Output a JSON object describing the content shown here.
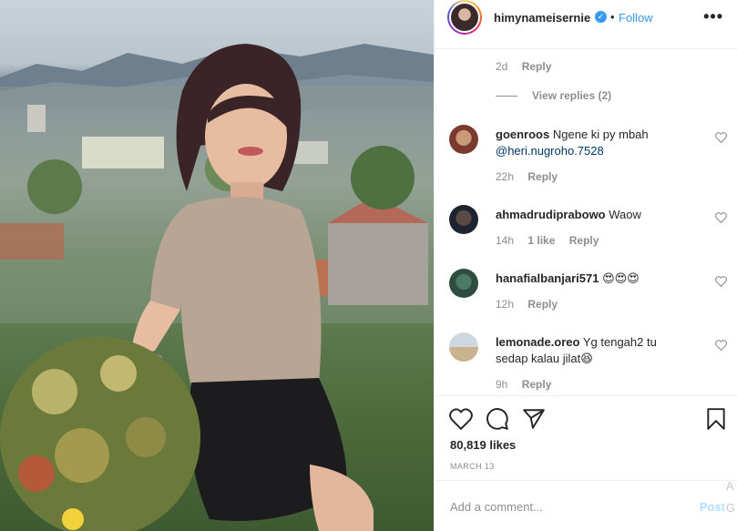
{
  "post": {
    "username": "himynameisernie",
    "verified_icon": "verified-badge-icon",
    "dot": "•",
    "follow_label": "Follow",
    "more_icon": "more-options-icon"
  },
  "earlier_reply": {
    "time": "2d",
    "reply_label": "Reply"
  },
  "view_replies": "View replies (2)",
  "comments": [
    {
      "username": "goenroos",
      "text": "Ngene ki py mbah",
      "mention": "@heri.nugroho.7528",
      "time": "22h",
      "likes": "",
      "reply_label": "Reply"
    },
    {
      "username": "ahmadrudiprabowo",
      "text": "Waow",
      "mention": "",
      "time": "14h",
      "likes": "1 like",
      "reply_label": "Reply"
    },
    {
      "username": "hanafialbanjari571",
      "text": "😍😍😍",
      "mention": "",
      "time": "12h",
      "likes": "",
      "reply_label": "Reply"
    },
    {
      "username": "lemonade.oreo",
      "text": "Yg tengah2 tu sedap kalau jilat😆",
      "mention": "",
      "time": "9h",
      "likes": "",
      "reply_label": "Reply"
    }
  ],
  "actions": {
    "like_icon": "heart-icon",
    "comment_icon": "comment-icon",
    "share_icon": "share-icon",
    "save_icon": "bookmark-icon"
  },
  "likes_count": "80,819 likes",
  "date": "MARCH 13",
  "add_comment_placeholder": "Add a comment...",
  "post_label": "Post",
  "watermark": "A\nG",
  "colors": {
    "link_blue": "#3897f0",
    "text": "#262626",
    "muted": "#8e8e8e",
    "post_disabled": "#b2dffc"
  }
}
